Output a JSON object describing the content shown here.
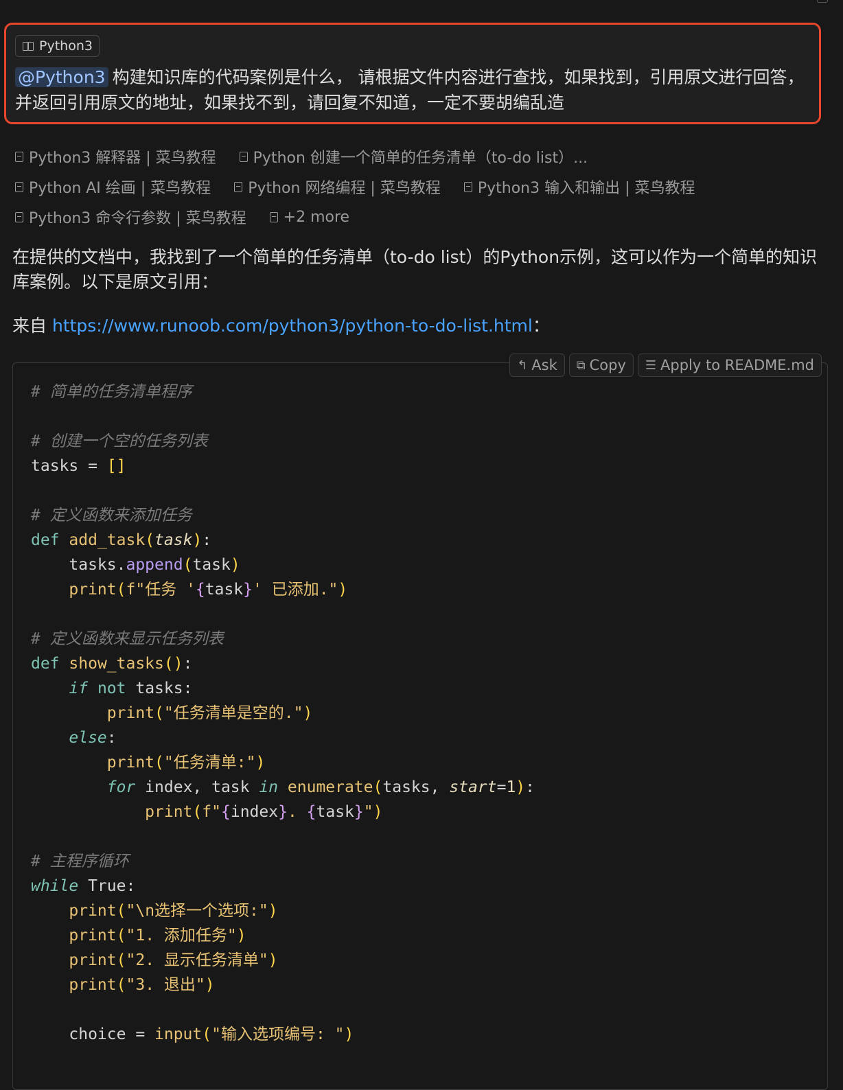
{
  "query": {
    "context_chip": "Python3",
    "mention": "@Python3",
    "text": "构建知识库的代码案例是什么， 请根据文件内容进行查找，如果找到，引用原文进行回答，并返回引用原文的地址，如果找不到，请回复不知道，一定不要胡编乱造"
  },
  "sources": [
    [
      "Python3 解释器 | 菜鸟教程",
      "Python 创建一个简单的任务清单（to-do list）..."
    ],
    [
      "Python AI 绘画 | 菜鸟教程",
      "Python 网络编程 | 菜鸟教程",
      "Python3 输入和输出 | 菜鸟教程"
    ],
    [
      "Python3 命令行参数 | 菜鸟教程",
      "+2 more"
    ]
  ],
  "answer": {
    "text": "在提供的文档中，我找到了一个简单的任务清单（to-do list）的Python示例，这可以作为一个简单的知识库案例。以下是原文引用：",
    "from_label": "来自",
    "url": "https://www.runoob.com/python3/python-to-do-list.html",
    "from_suffix": "："
  },
  "code_actions": {
    "ask": "Ask",
    "copy": "Copy",
    "apply": "Apply to README.md"
  },
  "icons": [
    "book-icon",
    "document-icon",
    "reply-icon",
    "copy-icon",
    "apply-icon"
  ]
}
